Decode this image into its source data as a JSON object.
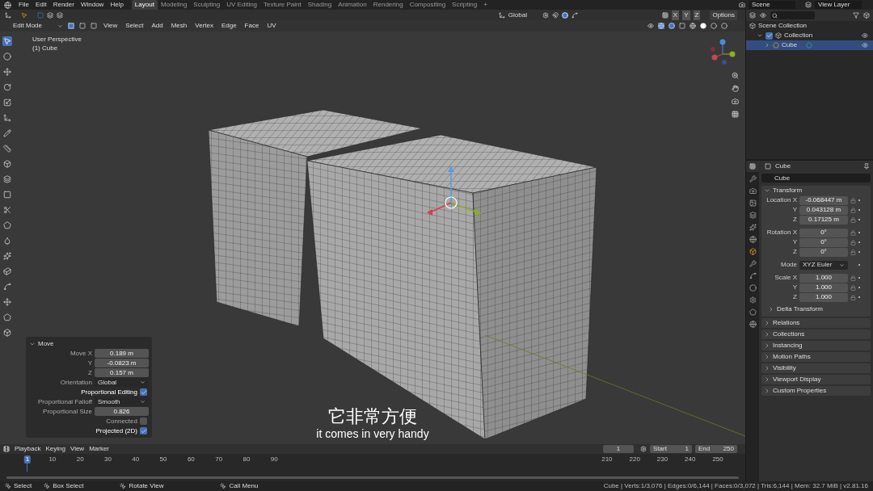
{
  "menu": [
    "File",
    "Edit",
    "Render",
    "Window",
    "Help"
  ],
  "workspaces": [
    {
      "label": "Layout",
      "selected": true
    },
    {
      "label": "Modeling",
      "selected": false
    },
    {
      "label": "Sculpting",
      "selected": false
    },
    {
      "label": "UV Editing",
      "selected": false
    },
    {
      "label": "Texture Paint",
      "selected": false
    },
    {
      "label": "Shading",
      "selected": false
    },
    {
      "label": "Animation",
      "selected": false
    },
    {
      "label": "Rendering",
      "selected": false
    },
    {
      "label": "Compositing",
      "selected": false
    },
    {
      "label": "Scripting",
      "selected": false
    }
  ],
  "add_workspace": "+",
  "scene": "Scene",
  "view_layer": "View Layer",
  "tool_header": {
    "orientation": "Global",
    "axes": [
      "X",
      "Y",
      "Z"
    ],
    "options": "Options"
  },
  "viewport_header": {
    "mode": "Edit Mode",
    "menus": [
      "View",
      "Select",
      "Add",
      "Mesh",
      "Vertex",
      "Edge",
      "Face",
      "UV"
    ]
  },
  "viewport": {
    "perspective": "User Perspective",
    "object": "(1) Cube"
  },
  "operator_panel": {
    "title": "Move",
    "expanded": true,
    "fields": [
      {
        "kind": "number",
        "label": "Move X",
        "value": "0.189 m"
      },
      {
        "kind": "number",
        "label": "Y",
        "value": "-0.0823 m"
      },
      {
        "kind": "number",
        "label": "Z",
        "value": "0.157 m"
      },
      {
        "kind": "dropdown",
        "label": "Orientation",
        "value": "Global"
      },
      {
        "kind": "checkbox",
        "label": "Proportional Editing",
        "checked": true
      },
      {
        "kind": "dropdown",
        "label": "Proportional Falloff",
        "value": "Smooth"
      },
      {
        "kind": "number",
        "label": "Proportional Size",
        "value": "0.826"
      },
      {
        "kind": "checkbox",
        "label": "Connected",
        "checked": false
      },
      {
        "kind": "checkbox",
        "label": "Projected (2D)",
        "checked": true
      }
    ]
  },
  "subtitles": [
    "它非常方便",
    "it comes in very handy"
  ],
  "outliner": {
    "items": [
      {
        "label": "Scene Collection",
        "children": [
          {
            "label": "Collection",
            "checked": true,
            "expanded": true,
            "children": [
              {
                "label": "Cube",
                "selected": true,
                "expanded": false
              }
            ]
          }
        ]
      }
    ]
  },
  "properties": {
    "object": "Cube",
    "name_field": "Cube",
    "transform": {
      "title": "Transform",
      "expanded": true,
      "rows": [
        {
          "kind": "number",
          "label": "Location X",
          "value": "-0.068447 m"
        },
        {
          "kind": "number",
          "label": "Y",
          "value": "0.043128 m"
        },
        {
          "kind": "number",
          "label": "Z",
          "value": "0.17125 m"
        },
        {
          "kind": "number",
          "label": "Rotation X",
          "value": "0°"
        },
        {
          "kind": "number",
          "label": "Y",
          "value": "0°"
        },
        {
          "kind": "number",
          "label": "Z",
          "value": "0°"
        },
        {
          "kind": "dropdown",
          "label": "Mode",
          "value": "XYZ Euler"
        },
        {
          "kind": "number",
          "label": "Scale X",
          "value": "1.000"
        },
        {
          "kind": "number",
          "label": "Y",
          "value": "1.000"
        },
        {
          "kind": "number",
          "label": "Z",
          "value": "1.000"
        }
      ],
      "subpanel": {
        "label": "Delta Transform",
        "expanded": false
      }
    },
    "panels": [
      {
        "label": "Relations",
        "expanded": false
      },
      {
        "label": "Collections",
        "expanded": false
      },
      {
        "label": "Instancing",
        "expanded": false
      },
      {
        "label": "Motion Paths",
        "expanded": false
      },
      {
        "label": "Visibility",
        "expanded": false
      },
      {
        "label": "Viewport Display",
        "expanded": false
      },
      {
        "label": "Custom Properties",
        "expanded": false
      }
    ]
  },
  "timeline": {
    "menus": [
      "Playback",
      "Keying",
      "View",
      "Marker"
    ],
    "current_frame": "1",
    "start_label": "Start",
    "start": "1",
    "end_label": "End",
    "end": "250",
    "ticks": [
      {
        "label": "1",
        "selected": true
      },
      {
        "label": "10",
        "selected": false
      },
      {
        "label": "20",
        "selected": false
      },
      {
        "label": "30",
        "selected": false
      },
      {
        "label": "40",
        "selected": false
      },
      {
        "label": "50",
        "selected": false
      },
      {
        "label": "60",
        "selected": false
      },
      {
        "label": "70",
        "selected": false
      },
      {
        "label": "80",
        "selected": false
      },
      {
        "label": "90",
        "selected": false
      },
      {
        "label": "210",
        "selected": false
      },
      {
        "label": "220",
        "selected": false
      },
      {
        "label": "230",
        "selected": false
      },
      {
        "label": "240",
        "selected": false
      },
      {
        "label": "250",
        "selected": false
      }
    ]
  },
  "status_bar": {
    "hints": [
      "Select",
      "Box Select",
      "Rotate View",
      "Call Menu"
    ],
    "stats": "Cube | Verts:1/3,076 | Edges:0/6,144 | Faces:0/3,072 | Tris:6,144 | Mem: 32.7 MiB | v2.81.16"
  }
}
